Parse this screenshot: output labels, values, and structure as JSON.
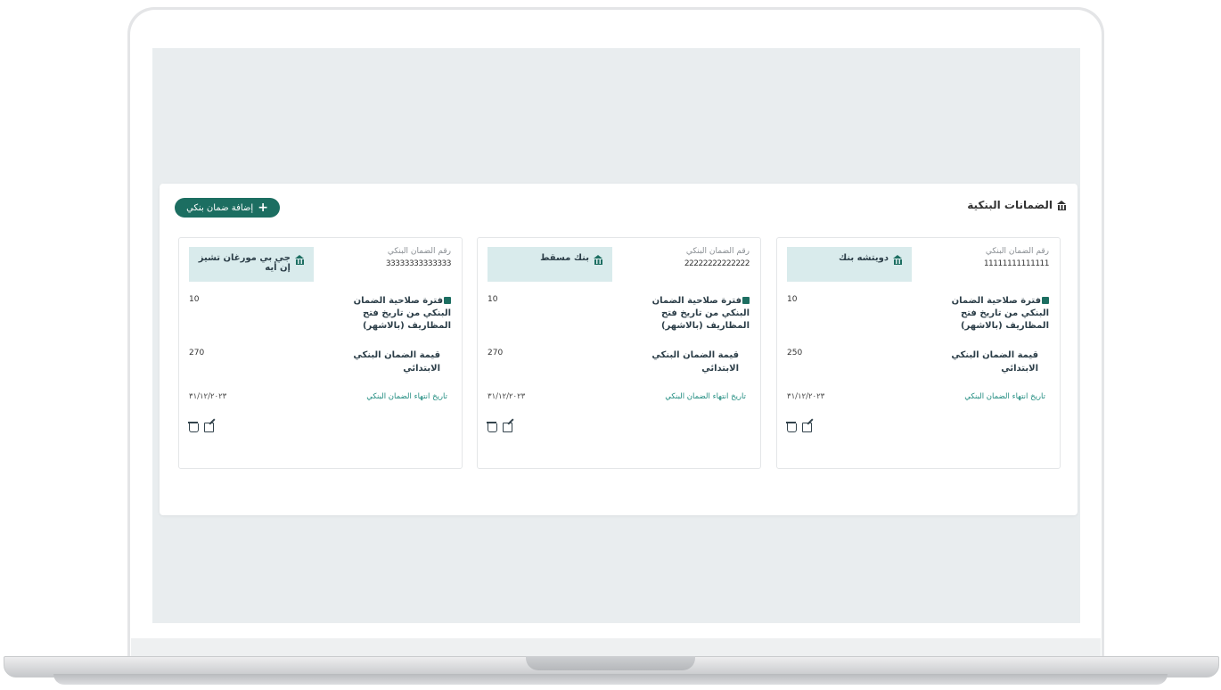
{
  "panel": {
    "title": "الضمانات البنكية",
    "add_button_label": "إضافة ضمان بنكي"
  },
  "labels": {
    "guarantee_number": "رقم الضمان البنكي",
    "validity": "فترة صلاحية الضمان البنكي من تاريخ فتح المظاريف (بالاشهر)",
    "initial_value": "قيمة الضمان البنكي الابتدائي",
    "end_date": "تاريخ انتهاء الضمان البنكي"
  },
  "cards": [
    {
      "guarantee_number": "11111111111111",
      "bank_name": "دويتشه بنك",
      "validity": "10",
      "initial_value": "250",
      "end_date": "٣١/١٢/٢٠٢٣"
    },
    {
      "guarantee_number": "22222222222222",
      "bank_name": "بنك مسقط",
      "validity": "10",
      "initial_value": "270",
      "end_date": "٣١/١٢/٢٠٢٣"
    },
    {
      "guarantee_number": "33333333333333",
      "bank_name": "جي بي مورغان تشيز إن أيه",
      "validity": "10",
      "initial_value": "270",
      "end_date": "٣١/١٢/٢٠٢٣"
    }
  ],
  "icons": {
    "bank": "bank-icon",
    "calendar": "calendar-icon",
    "edit": "edit-icon",
    "delete": "delete-icon"
  },
  "colors": {
    "accent": "#1c6e61",
    "name_box_bg": "#d9ebec",
    "screen_bg": "#e9edef"
  }
}
